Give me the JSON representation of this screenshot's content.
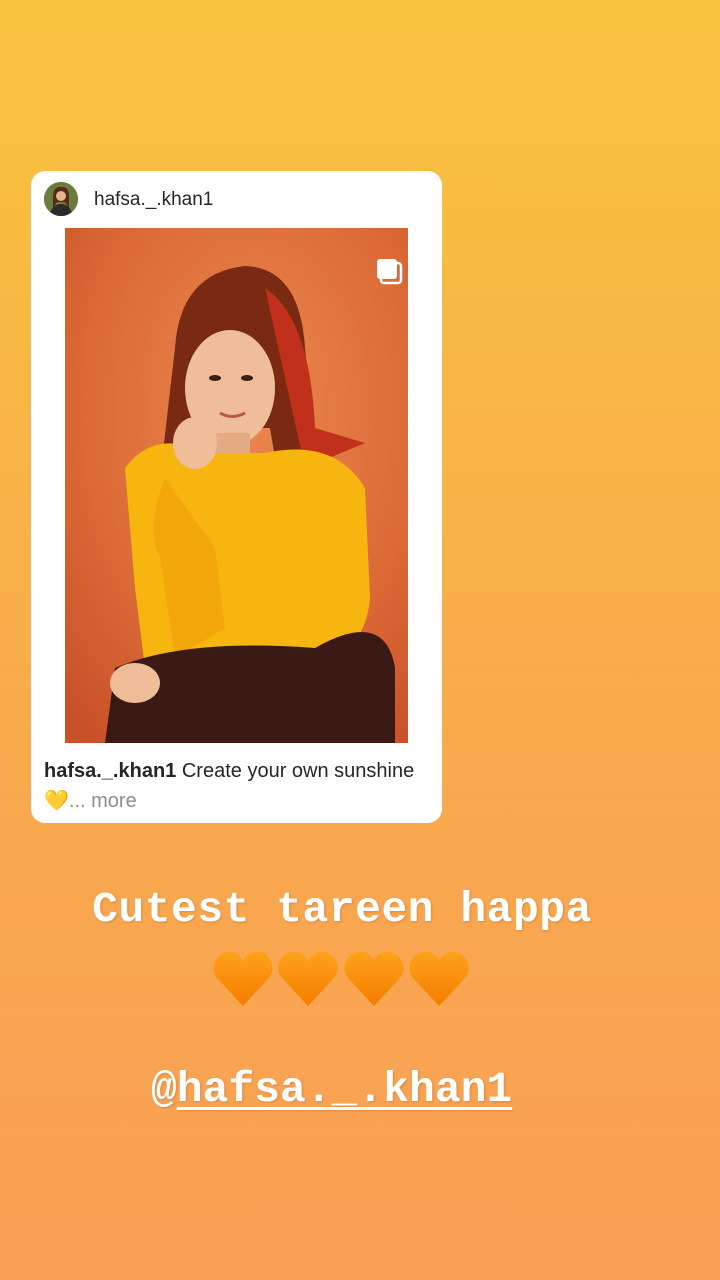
{
  "post": {
    "username": "hafsa._.khan1",
    "caption_user": "hafsa._.khan1",
    "caption_text": "Create your own sunshine💛",
    "caption_more": "... more"
  },
  "story": {
    "headline": "Cutest tareen happa",
    "hearts": [
      "orange-heart-emoji",
      "orange-heart-emoji",
      "orange-heart-emoji",
      "orange-heart-emoji"
    ],
    "mention_at": "@",
    "mention_name": "hafsa._.khan1"
  },
  "colors": {
    "gradient_top": "#f8c43f",
    "gradient_bottom": "#f9a055",
    "heart": "#ff8a00",
    "card": "#ffffff",
    "text_dark": "#262626",
    "more_gray": "#8e8e8e"
  }
}
